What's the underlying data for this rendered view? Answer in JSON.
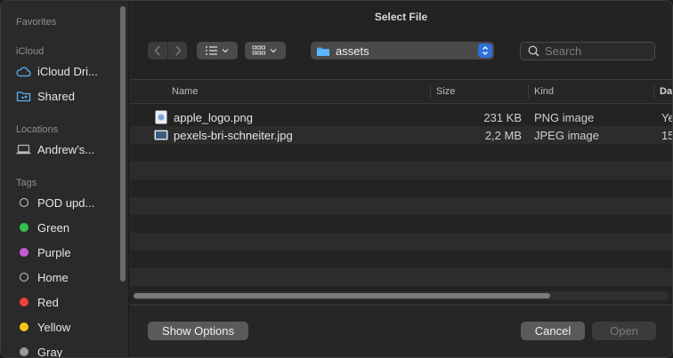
{
  "dialog": {
    "title": "Select File"
  },
  "sidebar": {
    "favorites_label": "Favorites",
    "icloud_label": "iCloud",
    "icloud_items": [
      {
        "label": "iCloud Dri...",
        "icon": "cloud-icon"
      },
      {
        "label": "Shared",
        "icon": "shared-folder-icon"
      }
    ],
    "locations_label": "Locations",
    "location_items": [
      {
        "label": "Andrew’s...",
        "icon": "laptop-icon"
      }
    ],
    "tags_label": "Tags",
    "tags": [
      {
        "label": "POD upd...",
        "color": "",
        "hollow": true
      },
      {
        "label": "Green",
        "color": "#32c24d"
      },
      {
        "label": "Purple",
        "color": "#c35bd6"
      },
      {
        "label": "Home",
        "color": "",
        "hollow": true
      },
      {
        "label": "Red",
        "color": "#f2413b"
      },
      {
        "label": "Yellow",
        "color": "#f5c518"
      },
      {
        "label": "Gray",
        "color": "#9a9a9a"
      }
    ]
  },
  "toolbar": {
    "location": "assets",
    "search_placeholder": "Search"
  },
  "columns": {
    "name": "Name",
    "size": "Size",
    "kind": "Kind",
    "date": "Da"
  },
  "files": [
    {
      "name": "apple_logo.png",
      "size": "231 KB",
      "kind": "PNG image",
      "date": "Ye",
      "icon": "png-file-icon"
    },
    {
      "name": "pexels-bri-schneiter.jpg",
      "size": "2,2 MB",
      "kind": "JPEG image",
      "date": "15",
      "icon": "jpeg-file-icon"
    }
  ],
  "empty_rows": 10,
  "buttons": {
    "show_options": "Show Options",
    "cancel": "Cancel",
    "open": "Open"
  }
}
